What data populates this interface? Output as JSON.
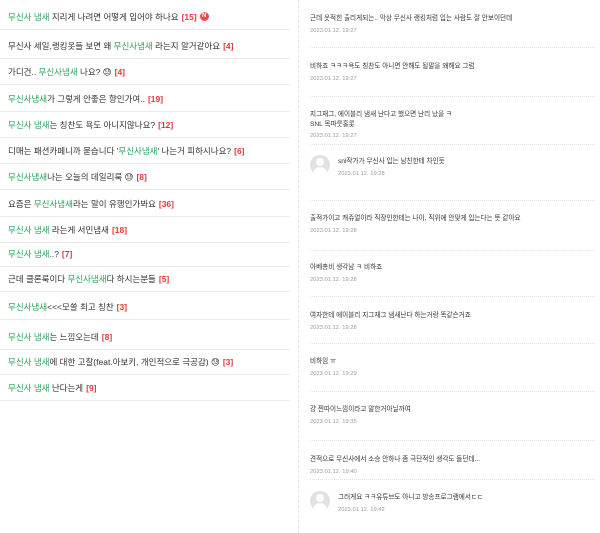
{
  "left_items": [
    {
      "parts": [
        {
          "t": "무신사 냄새",
          "kw": true
        },
        {
          "t": " 지리게 나려면 어떻게 입어야 하나요",
          "kw": false
        }
      ],
      "count": "[15]",
      "new": "N"
    },
    {
      "parts": [
        {
          "t": "무신사 세일,랭킹옷들 보면 왜 ",
          "kw": false
        },
        {
          "t": "무신사냄새",
          "kw": true
        },
        {
          "t": " 라는지 알거같아요",
          "kw": false
        }
      ],
      "count": "[4]"
    },
    {
      "parts": [
        {
          "t": "가디건.. ",
          "kw": false
        },
        {
          "t": "무신사냄새",
          "kw": true
        },
        {
          "t": " 나요? 😓",
          "kw": false
        }
      ],
      "count": "[4]"
    },
    {
      "parts": [
        {
          "t": "무신사냄새",
          "kw": true
        },
        {
          "t": "가 그렇게 안좋은 향인가여..",
          "kw": false
        }
      ],
      "count": "[19]"
    },
    {
      "parts": [
        {
          "t": "무신사 냄새",
          "kw": true
        },
        {
          "t": "는 칭찬도 욕도 아니지않나요?",
          "kw": false
        }
      ],
      "count": "[12]"
    },
    {
      "parts": [
        {
          "t": "디매는 패션카페니까 묻습니다 '",
          "kw": false
        },
        {
          "t": "무신사냄새",
          "kw": true
        },
        {
          "t": "' 나는거 피하시나요?",
          "kw": false
        }
      ],
      "count": "[6]"
    },
    {
      "parts": [
        {
          "t": "무신사냄새",
          "kw": true
        },
        {
          "t": "나는 오늘의 데일리룩 😓",
          "kw": false
        }
      ],
      "count": "[8]"
    },
    {
      "parts": [
        {
          "t": "요즘은 ",
          "kw": false
        },
        {
          "t": "무신사냄새",
          "kw": true
        },
        {
          "t": "라는 말이 유행인가봐요",
          "kw": false
        }
      ],
      "count": "[36]"
    },
    {
      "parts": [
        {
          "t": "무신사 냄새",
          "kw": true
        },
        {
          "t": " 라는게 서민냄새",
          "kw": false
        }
      ],
      "count": "[18]"
    },
    {
      "parts": [
        {
          "t": "무신사 냄새",
          "kw": true
        },
        {
          "t": "..?",
          "kw": false
        }
      ],
      "count": "[7]"
    },
    {
      "parts": [
        {
          "t": "근데 클론룩이다 ",
          "kw": false
        },
        {
          "t": "무신사냄새",
          "kw": true
        },
        {
          "t": "다 하시는분들",
          "kw": false
        }
      ],
      "count": "[5]"
    },
    {
      "parts": [
        {
          "t": "무신사냄새",
          "kw": true
        },
        {
          "t": "<<<모쏠 최고 칭찬",
          "kw": false
        }
      ],
      "count": "[3]"
    },
    {
      "parts": [
        {
          "t": "무신사 냄새",
          "kw": true
        },
        {
          "t": "는 느낌오는데",
          "kw": false
        }
      ],
      "count": "[8]"
    },
    {
      "parts": [
        {
          "t": "무신사 냄새",
          "kw": true
        },
        {
          "t": "에 대한 고찰(feat.아보키, 개인적으로 극공감) 😓",
          "kw": false
        }
      ],
      "count": "[3]"
    },
    {
      "parts": [
        {
          "t": "무신사 냄새",
          "kw": true
        },
        {
          "t": " 난다는게",
          "kw": false
        }
      ],
      "count": "[9]"
    }
  ],
  "comments": [
    {
      "text": "근데 옷적힌 출리게되는.. 막상 무신사 랭킹처럼 입는 사람도 잘 안보이던데",
      "date": "2023.01.12. 19:27",
      "reply": false
    },
    {
      "text": "비하죠 ㅋㅋㅋ욕도 칭찬도 아니면 안해도 될말을 왜해요 그럼",
      "date": "2023.01.12. 19:27",
      "reply": false
    },
    {
      "text": "지그재그, 에이블리 냄새 난다고 했으면 난리 났을 ㅋ",
      "text2": "SNL 목파룻홍롯",
      "date": "2023.01.12. 19:27",
      "reply": false
    },
    {
      "text": "snl작가가 무신사 입는 남친한테 차인듯",
      "date": "2023.01.12. 19:28",
      "reply": true
    },
    {
      "text": "출적가이고 캐쥬얼이라 직장인한테는 나이, 직위에 안맞게 입는다는 뜻 같아요",
      "date": "2023.01.12. 19:28",
      "reply": false
    },
    {
      "text": "아베총비 생각남 ㅋ 비하죠",
      "date": "2023.01.12. 19:28",
      "reply": false
    },
    {
      "text": "여자한테 에이블리 지그재그 냄새난다 하는거랑 똑같슨거죠",
      "date": "2023.01.12. 19:28",
      "reply": false
    },
    {
      "text": "비하임 ㅠ",
      "date": "2023.01.12. 19:29",
      "reply": false
    },
    {
      "text": "걍 찐따이느낌이라고 말한거아닐까여",
      "date": "2023.01.12. 19:35",
      "reply": false
    },
    {
      "text": "견적으로 무신사에서 소승 안하나 좀 극단적인 생각도 들던데...",
      "date": "2023.01.12. 19:40",
      "reply": false
    },
    {
      "text": "그러게요 ㅋㅋ유튜브도 아니고 방송프로그램에서ㄷㄷ",
      "date": "2023.01.12. 19:42",
      "reply": true
    }
  ],
  "colors": {
    "keyword": "#27a057",
    "count": "#e0393e",
    "date": "#9a9a9a"
  }
}
